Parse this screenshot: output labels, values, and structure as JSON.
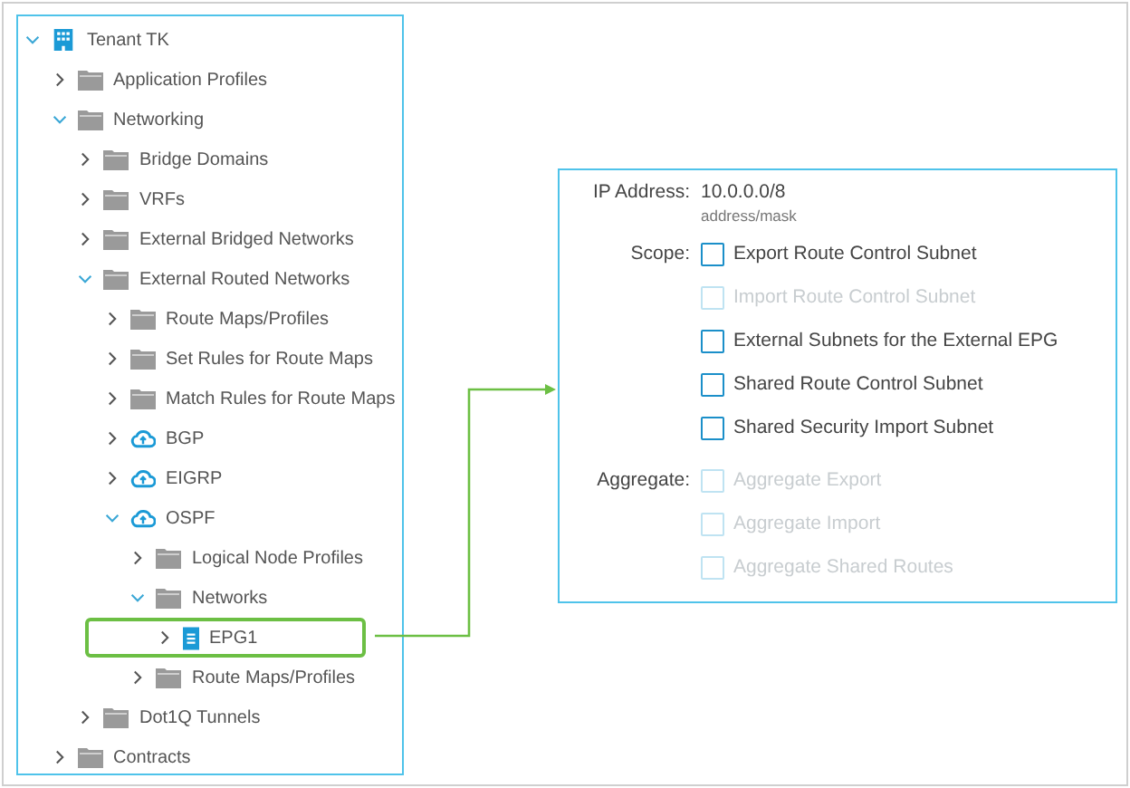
{
  "tree": [
    {
      "label": "Tenant TK",
      "kind": "tenant",
      "expanded": true,
      "selected": false,
      "children": [
        {
          "label": "Application Profiles",
          "kind": "folder",
          "expanded": false,
          "selected": false
        },
        {
          "label": "Networking",
          "kind": "folder",
          "expanded": true,
          "selected": false,
          "children": [
            {
              "label": "Bridge Domains",
              "kind": "folder",
              "expanded": false,
              "selected": false
            },
            {
              "label": "VRFs",
              "kind": "folder",
              "expanded": false,
              "selected": false
            },
            {
              "label": "External Bridged Networks",
              "kind": "folder",
              "expanded": false,
              "selected": false
            },
            {
              "label": "External Routed Networks",
              "kind": "folder",
              "expanded": true,
              "selected": false,
              "children": [
                {
                  "label": "Route Maps/Profiles",
                  "kind": "folder",
                  "expanded": false,
                  "selected": false
                },
                {
                  "label": "Set Rules for Route Maps",
                  "kind": "folder",
                  "expanded": false,
                  "selected": false
                },
                {
                  "label": "Match Rules for Route Maps",
                  "kind": "folder",
                  "expanded": false,
                  "selected": false
                },
                {
                  "label": "BGP",
                  "kind": "cloud",
                  "expanded": false,
                  "selected": false
                },
                {
                  "label": "EIGRP",
                  "kind": "cloud",
                  "expanded": false,
                  "selected": false
                },
                {
                  "label": "OSPF",
                  "kind": "cloud",
                  "expanded": true,
                  "selected": false,
                  "children": [
                    {
                      "label": "Logical Node Profiles",
                      "kind": "folder",
                      "expanded": false,
                      "selected": false
                    },
                    {
                      "label": "Networks",
                      "kind": "folder",
                      "expanded": true,
                      "selected": false,
                      "children": [
                        {
                          "label": "EPG1",
                          "kind": "epg",
                          "expanded": false,
                          "selected": true
                        }
                      ]
                    },
                    {
                      "label": "Route Maps/Profiles",
                      "kind": "folder",
                      "expanded": false,
                      "selected": false
                    }
                  ]
                }
              ]
            },
            {
              "label": "Dot1Q Tunnels",
              "kind": "folder",
              "expanded": false,
              "selected": false
            }
          ]
        },
        {
          "label": "Contracts",
          "kind": "folder",
          "expanded": false,
          "selected": false
        }
      ]
    }
  ],
  "form": {
    "ip_label": "IP Address:",
    "ip_value": "10.0.0.0/8",
    "ip_hint": "address/mask",
    "groups": [
      {
        "label": "Scope:",
        "options": [
          {
            "label": "Export Route Control Subnet",
            "checked": false,
            "disabled": false
          },
          {
            "label": "Import Route Control Subnet",
            "checked": false,
            "disabled": true
          },
          {
            "label": "External Subnets for the External EPG",
            "checked": false,
            "disabled": false
          },
          {
            "label": "Shared Route Control Subnet",
            "checked": false,
            "disabled": false
          },
          {
            "label": "Shared Security Import Subnet",
            "checked": false,
            "disabled": false
          }
        ]
      },
      {
        "label": "Aggregate:",
        "options": [
          {
            "label": "Aggregate Export",
            "checked": false,
            "disabled": true
          },
          {
            "label": "Aggregate Import",
            "checked": false,
            "disabled": true
          },
          {
            "label": "Aggregate Shared Routes",
            "checked": false,
            "disabled": true
          }
        ]
      }
    ]
  }
}
